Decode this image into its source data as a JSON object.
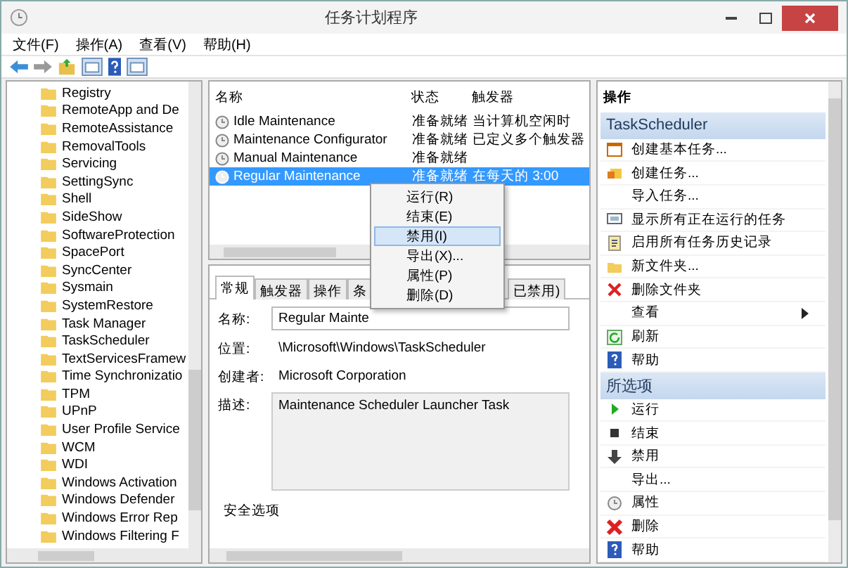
{
  "window": {
    "title": "任务计划程序"
  },
  "menu_bar": [
    "文件(F)",
    "操作(A)",
    "查看(V)",
    "帮助(H)"
  ],
  "tree": {
    "items": [
      "Registry",
      "RemoteApp and De",
      "RemoteAssistance",
      "RemovalTools",
      "Servicing",
      "SettingSync",
      "Shell",
      "SideShow",
      "SoftwareProtection",
      "SpacePort",
      "SyncCenter",
      "Sysmain",
      "SystemRestore",
      "Task Manager",
      "TaskScheduler",
      "TextServicesFramew",
      "Time Synchronizatio",
      "TPM",
      "UPnP",
      "User Profile Service",
      "WCM",
      "WDI",
      "Windows Activation",
      "Windows Defender",
      "Windows Error Rep",
      "Windows Filtering F"
    ]
  },
  "task_list": {
    "columns": [
      "名称",
      "状态",
      "触发器"
    ],
    "rows": [
      {
        "name": "Idle Maintenance",
        "status": "准备就绪",
        "trigger": "当计算机空闲时",
        "selected": false
      },
      {
        "name": "Maintenance Configurator",
        "status": "准备就绪",
        "trigger": "已定义多个触发器",
        "selected": false
      },
      {
        "name": "Manual Maintenance",
        "status": "准备就绪",
        "trigger": "",
        "selected": false
      },
      {
        "name": "Regular Maintenance",
        "status": "准备就绪",
        "trigger": "在每天的 3:00",
        "selected": true
      }
    ]
  },
  "context_menu": [
    {
      "label": "运行(R)",
      "selected": false
    },
    {
      "label": "结束(E)",
      "selected": false
    },
    {
      "label": "禁用(I)",
      "selected": true
    },
    {
      "label": "导出(X)...",
      "selected": false
    },
    {
      "label": "属性(P)",
      "selected": false
    },
    {
      "label": "删除(D)",
      "selected": false
    }
  ],
  "detail": {
    "tabs": [
      {
        "label": "常规",
        "selected": true
      },
      {
        "label": "触发器",
        "selected": false
      },
      {
        "label": "操作",
        "selected": false
      },
      {
        "label": "条",
        "selected": false
      },
      {
        "label": "已禁用)",
        "selected": false
      }
    ],
    "fields": [
      {
        "label": "名称:",
        "value": "Regular Mainte",
        "kind": "input"
      },
      {
        "label": "位置:",
        "value": "\\Microsoft\\Windows\\TaskScheduler",
        "kind": "text"
      },
      {
        "label": "创建者:",
        "value": "Microsoft Corporation",
        "kind": "text"
      },
      {
        "label": "描述:",
        "value": "Maintenance Scheduler Launcher Task",
        "kind": "textarea"
      }
    ],
    "security_group": "安全选项"
  },
  "actions": {
    "header": "操作",
    "sections": [
      {
        "title": "TaskScheduler",
        "items": [
          {
            "label": "创建基本任务...",
            "kind": "action"
          },
          {
            "label": "创建任务...",
            "kind": "action"
          },
          {
            "label": "导入任务...",
            "kind": "action"
          },
          {
            "label": "显示所有正在运行的任务",
            "kind": "action"
          },
          {
            "label": "启用所有任务历史记录",
            "kind": "action"
          },
          {
            "label": "新文件夹...",
            "kind": "action"
          },
          {
            "label": "删除文件夹",
            "kind": "action"
          },
          {
            "label": "查看",
            "kind": "submenu"
          },
          {
            "label": "刷新",
            "kind": "action"
          },
          {
            "label": "帮助",
            "kind": "action"
          }
        ]
      },
      {
        "title": "所选项",
        "items": [
          {
            "label": "运行",
            "kind": "action"
          },
          {
            "label": "结束",
            "kind": "action"
          },
          {
            "label": "禁用",
            "kind": "action"
          },
          {
            "label": "导出...",
            "kind": "action"
          },
          {
            "label": "属性",
            "kind": "action"
          },
          {
            "label": "删除",
            "kind": "action"
          },
          {
            "label": "帮助",
            "kind": "action"
          }
        ]
      }
    ]
  }
}
